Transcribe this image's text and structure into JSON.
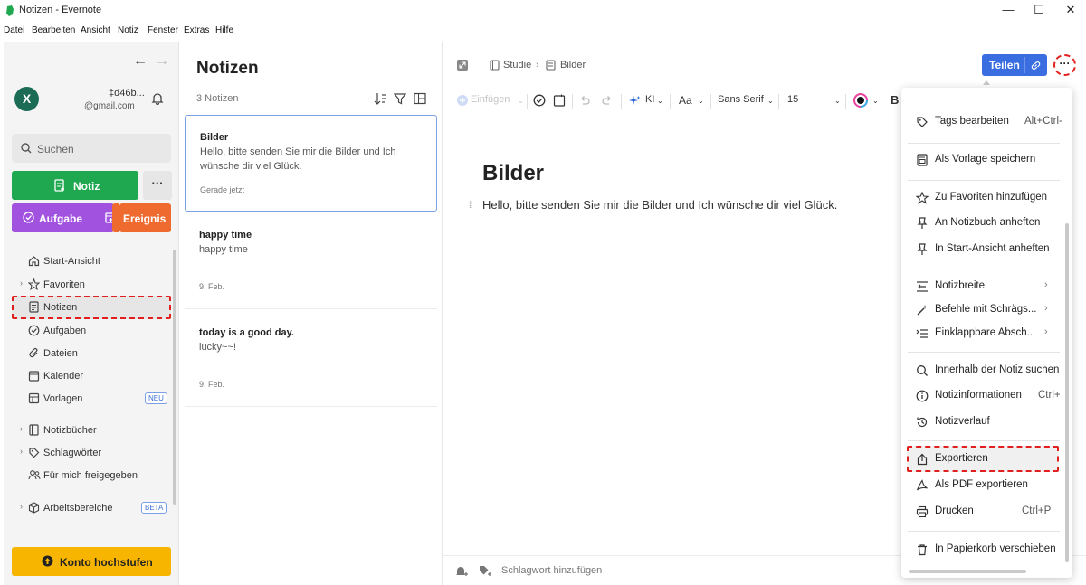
{
  "window": {
    "title": "Notizen - Evernote",
    "minimize": "—",
    "maximize": "☐",
    "close": "✕"
  },
  "menubar": [
    "Datei",
    "Bearbeiten",
    "Ansicht",
    "Notiz",
    "Fenster",
    "Extras",
    "Hilfe"
  ],
  "sidebar": {
    "back": "←",
    "forward": "→",
    "avatar_letter": "X",
    "account_name": "‡d46b...",
    "account_email": "@gmail.com",
    "search_placeholder": "Suchen",
    "new_note": "Notiz",
    "more": "···",
    "task": "Aufgabe",
    "event": "Ereignis",
    "nav": [
      {
        "label": "Start-Ansicht"
      },
      {
        "label": "Favoriten"
      },
      {
        "label": "Notizen"
      },
      {
        "label": "Aufgaben"
      },
      {
        "label": "Dateien"
      },
      {
        "label": "Kalender"
      },
      {
        "label": "Vorlagen",
        "badge": "NEU"
      },
      {
        "label": "Notizbücher"
      },
      {
        "label": "Schlagwörter"
      },
      {
        "label": "Für mich freigegeben"
      },
      {
        "label": "Arbeitsbereiche",
        "badge": "BETA"
      }
    ],
    "upgrade": "Konto hochstufen"
  },
  "notelist": {
    "title": "Notizen",
    "count": "3 Notizen",
    "notes": [
      {
        "title": "Bilder",
        "body": "Hello, bitte senden Sie mir die Bilder und Ich wünsche dir viel Glück.",
        "date": "Gerade jetzt"
      },
      {
        "title": "happy time",
        "body": "happy time",
        "date": "9. Feb."
      },
      {
        "title": "today is a good day.",
        "body": "lucky~~!",
        "date": "9. Feb."
      }
    ]
  },
  "editor": {
    "breadcrumb": {
      "notebook": "Studie",
      "sep": "›",
      "note": "Bilder"
    },
    "share": "Teilen",
    "more": "···",
    "toolbar": {
      "insert": "Einfügen",
      "ai": "KI",
      "text_style": "Aa",
      "font": "Sans Serif",
      "size": "15",
      "bold": "B"
    },
    "doc_title": "Bilder",
    "doc_body": "Hello, bitte senden Sie mir die Bilder und Ich wünsche dir viel Glück.",
    "tag_placeholder": "Schlagwort hinzufügen"
  },
  "context_menu": {
    "items": [
      {
        "label": "Tags bearbeiten",
        "shortcut": "Alt+Ctrl-"
      },
      {
        "label": "Als Vorlage speichern"
      },
      {
        "label": "Zu Favoriten hinzufügen"
      },
      {
        "label": "An Notizbuch anheften"
      },
      {
        "label": "In Start-Ansicht anheften"
      },
      {
        "label": "Notizbreite",
        "arrow": "›"
      },
      {
        "label": "Befehle mit Schrägs...",
        "arrow": "›"
      },
      {
        "label": "Einklappbare Absch...",
        "arrow": "›"
      },
      {
        "label": "Innerhalb der Notiz suchen"
      },
      {
        "label": "Notizinformationen",
        "shortcut": "Ctrl+"
      },
      {
        "label": "Notizverlauf"
      },
      {
        "label": "Exportieren"
      },
      {
        "label": "Als PDF exportieren"
      },
      {
        "label": "Drucken",
        "shortcut": "Ctrl+P"
      },
      {
        "label": "In Papierkorb verschieben"
      }
    ]
  },
  "colors": {
    "note_green": "#1fa84f",
    "task_purple": "#a153e0",
    "event_orange": "#ee6a2e",
    "upgrade_yellow": "#f7b500",
    "share_blue": "#3a6ee0",
    "highlight_red": "#e0201e"
  }
}
